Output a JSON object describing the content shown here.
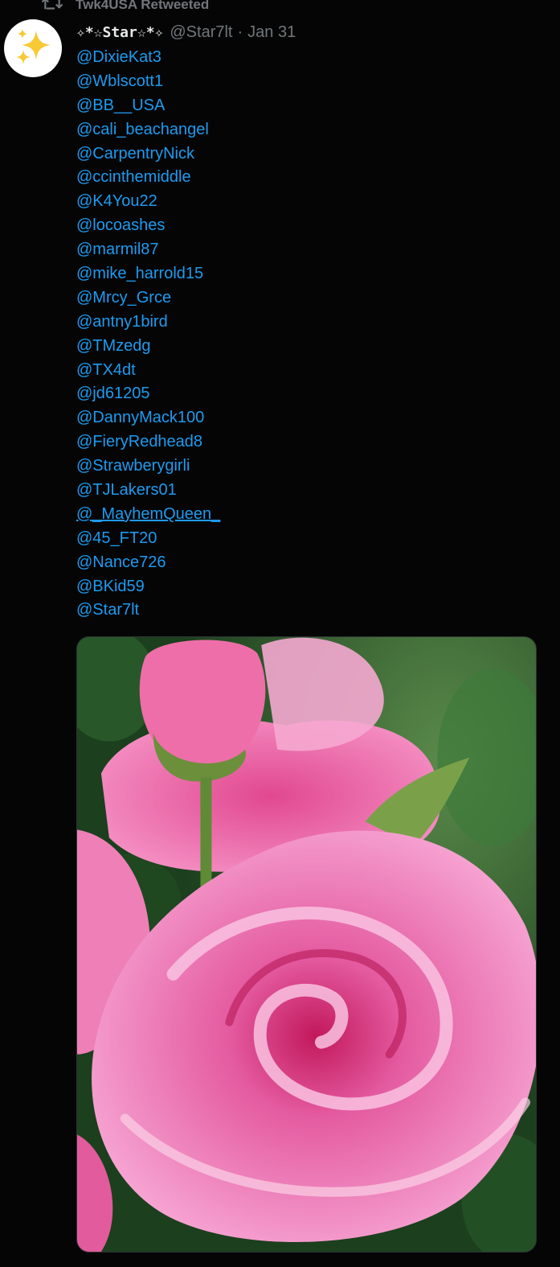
{
  "retweet": {
    "icon": "retweet-icon",
    "label": "Twk4USA Retweeted"
  },
  "tweet": {
    "avatar_icon": "sparkles-icon",
    "display_name": "✧*☆Star☆*✧",
    "handle": "@Star7lt",
    "separator": "·",
    "date": "Jan 31",
    "mentions": [
      "@DixieKat3",
      "@Wblscott1",
      "@BB__USA",
      "@cali_beachangel",
      "@CarpentryNick",
      "@ccinthemiddle",
      "@K4You22",
      "@locoashes",
      "@marmil87",
      "@mike_harrold15",
      "@Mrcy_Grce",
      "@antny1bird",
      "@TMzedg",
      "@TX4dt",
      "@jd61205",
      "@DannyMack100",
      "@FieryRedhead8",
      "@Strawberygirli",
      "@TJLakers01",
      "@_MayhemQueen_",
      "@45_FT20",
      "@Nance726",
      "@BKid59",
      "@Star7lt"
    ],
    "media": {
      "kind": "photo",
      "subject": "pink roses",
      "colors": {
        "petal": "#f27bbf",
        "petal_dark": "#d63c8a",
        "leaf": "#2f6b2f"
      }
    }
  },
  "colors": {
    "background": "#050505",
    "link": "#1d9bf0",
    "secondary_text": "#71767b",
    "primary_text": "#e7e9ea"
  }
}
